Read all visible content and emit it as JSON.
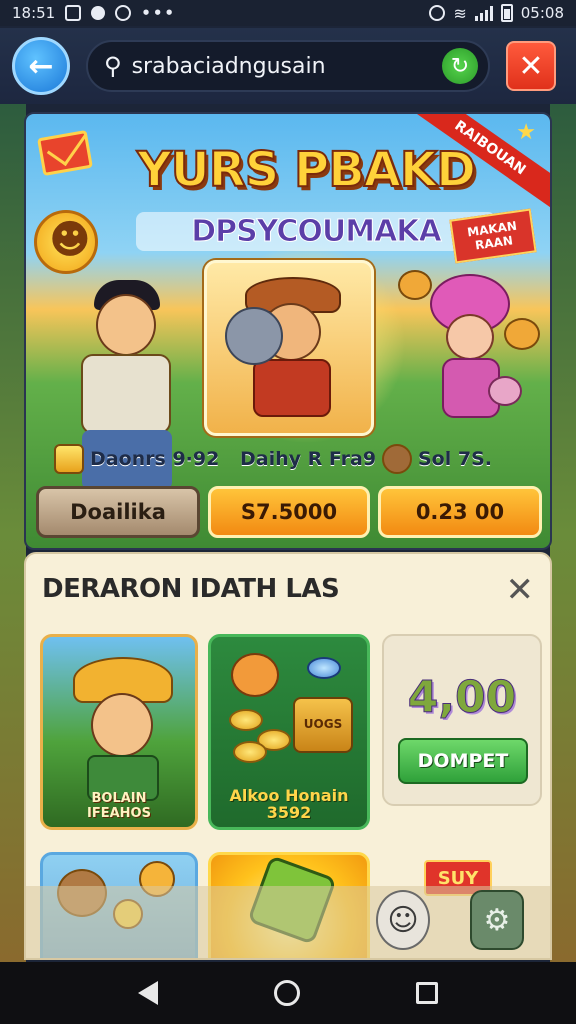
{
  "status_bar": {
    "time_left": "18:51",
    "more": "•••",
    "time_right": "05:08"
  },
  "toolbar": {
    "search_query": "srabaciadngusain",
    "back_icon": "arrow-left-icon",
    "refresh_icon": "refresh-icon",
    "close_icon": "close-icon"
  },
  "banner": {
    "title": "YURS PBAKD",
    "subtitle": "DPSYCOUMAKA",
    "corner_ribbon": "RAIBOUAN",
    "side_tag": "MAKAN RAAN",
    "stats": [
      {
        "label": "Daonrs 9·92"
      },
      {
        "label": "Daihy R Fra9"
      },
      {
        "label": "Sol 7S."
      }
    ],
    "buttons": {
      "left": "Doailika",
      "middle": "S7.5000",
      "right": "0.23 00"
    }
  },
  "panel": {
    "title": "DERARON IDATH LAS",
    "close_label": "✕",
    "card_1_caption_1": "BOLAIN",
    "card_1_caption_2": "IFEAHOS",
    "card_2_caption_1": "Alkoo Honain",
    "card_2_caption_2": "3592",
    "card_2_barrel_text": "UOGS",
    "card_3_value": "4,00",
    "card_3_button": "DOMPET",
    "sale_tag": "SUY"
  },
  "colors": {
    "accent_orange": "#f28a12",
    "accent_green": "#2fa13a",
    "close_red": "#e0311b",
    "back_blue": "#1b78d8"
  }
}
